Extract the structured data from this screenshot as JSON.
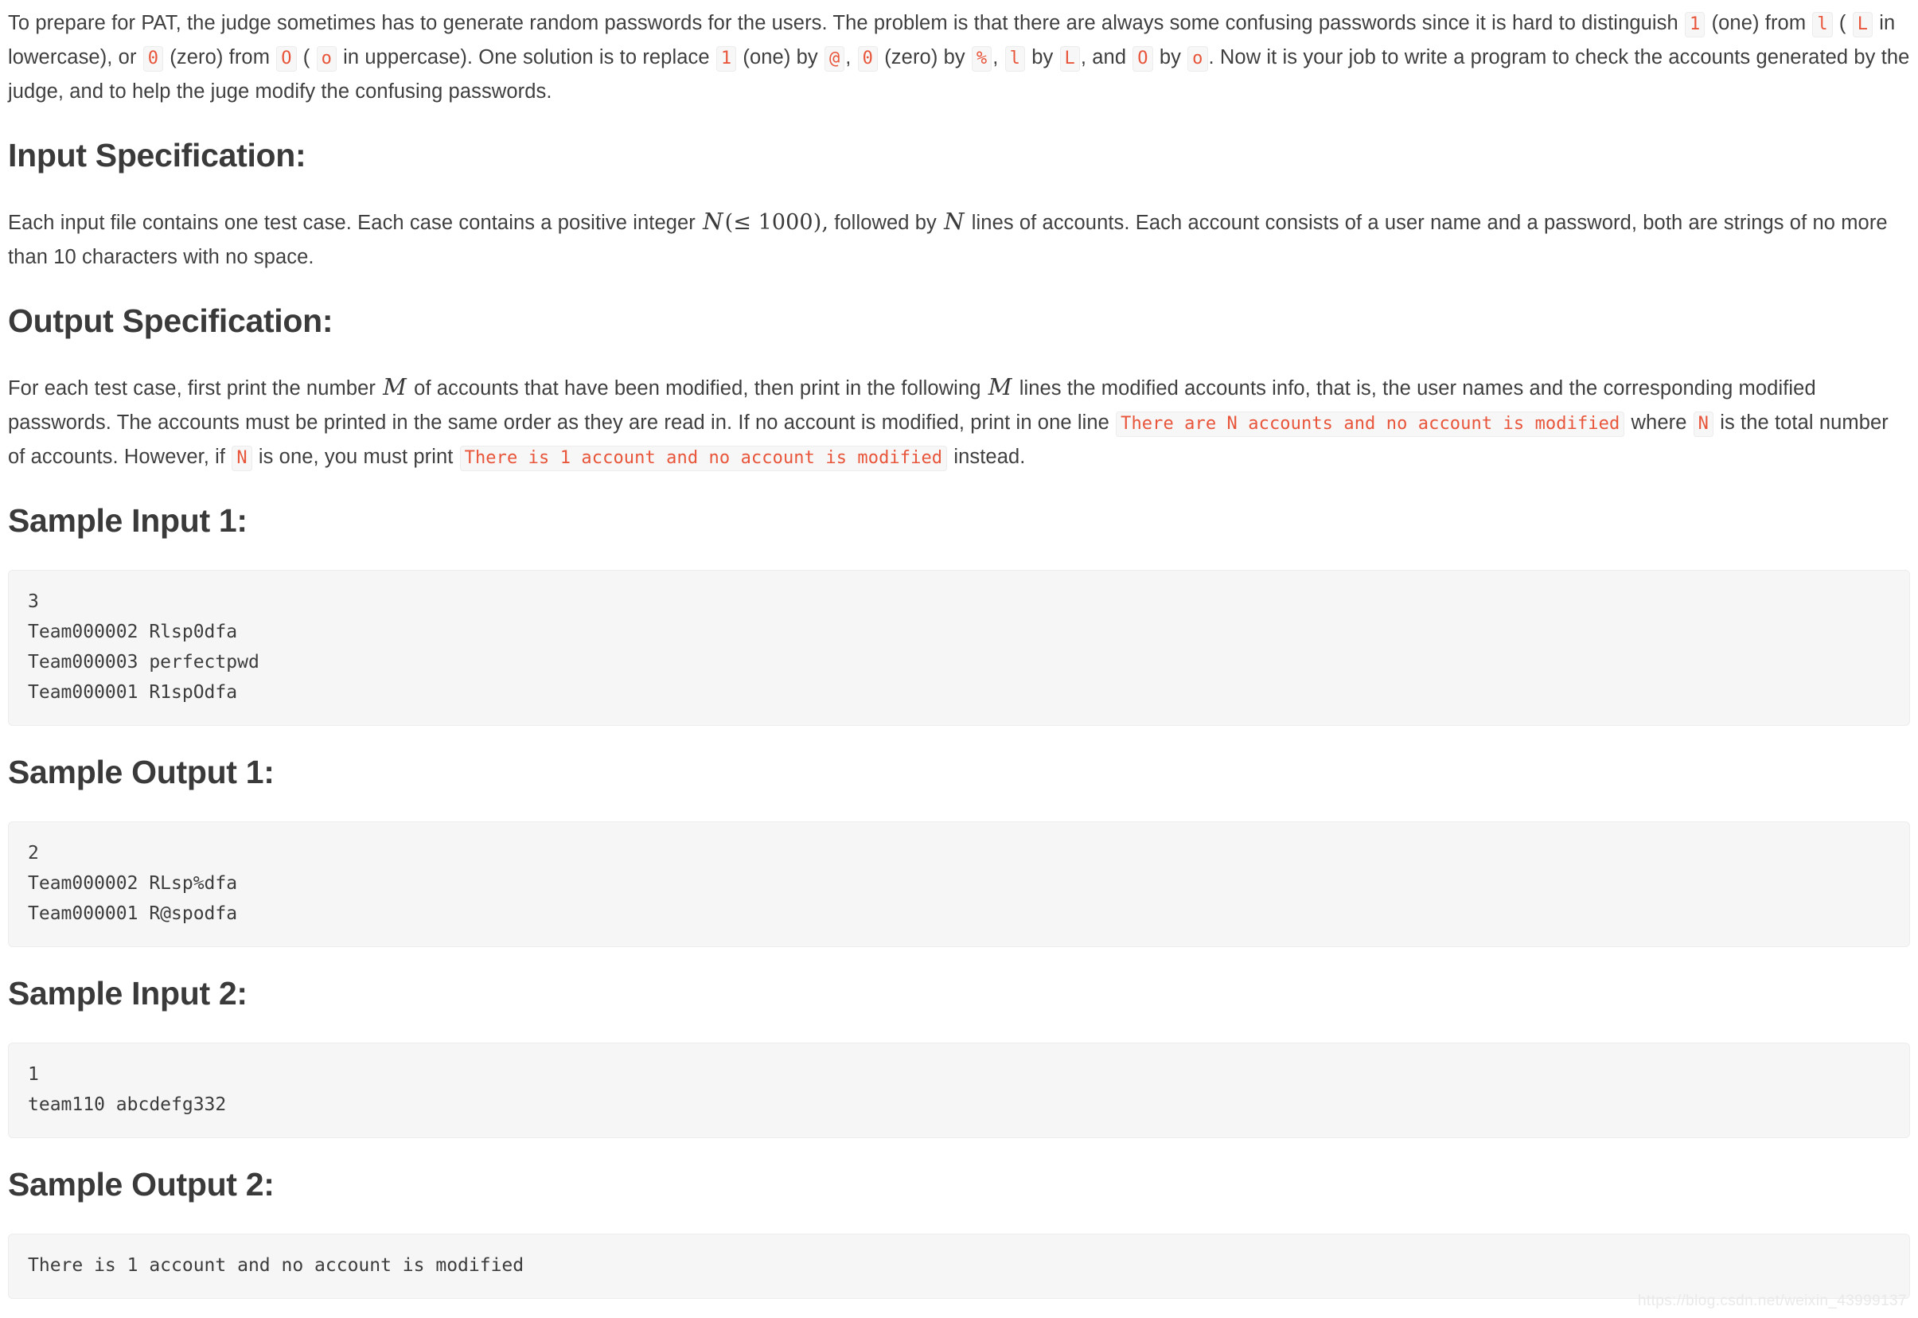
{
  "intro": {
    "part1": "To prepare for PAT, the judge sometimes has to generate random passwords for the users. The problem is that there are always some confusing passwords since it is hard to distinguish",
    "code_one": "1",
    "part2": "(one) from",
    "code_l_lower": "l",
    "part3": "(",
    "code_L_upper": "L",
    "part4": "in lowercase), or",
    "code_zero_slashed": "0",
    "part5": "(zero) from",
    "code_O_upper": "O",
    "part6": "(",
    "code_o_lower": "o",
    "part7": "in uppercase). One solution is to replace",
    "code_one_2": "1",
    "part8": "(one) by",
    "code_at": "@",
    "part9": ",",
    "code_zero_slashed_2": "0",
    "part10": "(zero) by",
    "code_percent": "%",
    "part11": ",",
    "code_l_lower_2": "l",
    "part12": "by",
    "code_L_upper_2": "L",
    "part13": ", and",
    "code_O_upper_2": "O",
    "part14": "by",
    "code_o_lower_2": "o",
    "part15": ". Now it is your job to write a program to check the accounts generated by the judge, and to help the juge modify the confusing passwords."
  },
  "input_spec": {
    "heading": "Input Specification:",
    "part1": "Each input file contains one test case. Each case contains a positive integer",
    "var_N": "N",
    "limit": "(≤ 1000),",
    "part2": "followed by",
    "var_N2": "N",
    "part3": "lines of accounts. Each account consists of a user name and a password, both are strings of no more than 10 characters with no space."
  },
  "output_spec": {
    "heading": "Output Specification:",
    "part1": "For each test case, first print the number",
    "var_M": "M",
    "part2": "of accounts that have been modified, then print in the following",
    "var_M2": "M",
    "part3": "lines the modified accounts info, that is, the user names and the corresponding modified passwords. The accounts must be printed in the same order as they are read in. If no account is modified, print in one line",
    "code_no_mod": "There are N accounts and no account is modified",
    "part4": "where",
    "code_N": "N",
    "part5": "is the total number of accounts. However, if",
    "code_N2": "N",
    "part6": "is one, you must print",
    "code_one_account": "There is 1 account and no account is modified",
    "part7": "instead."
  },
  "samples": [
    {
      "heading": "Sample Input 1:",
      "code": "3\nTeam000002 Rlsp0dfa\nTeam000003 perfectpwd\nTeam000001 R1spOdfa"
    },
    {
      "heading": "Sample Output 1:",
      "code": "2\nTeam000002 RLsp%dfa\nTeam000001 R@spodfa"
    },
    {
      "heading": "Sample Input 2:",
      "code": "1\nteam110 abcdefg332"
    },
    {
      "heading": "Sample Output 2:",
      "code": "There is 1 account and no account is modified"
    }
  ],
  "watermark": "https://blog.csdn.net/weixin_43999137",
  "colors": {
    "inline_code_text": "#e8553a",
    "inline_code_bg": "#f7f7f7",
    "code_block_bg": "#f6f6f6",
    "heading": "#3a3a3a",
    "body_text": "#3f3f3f"
  }
}
